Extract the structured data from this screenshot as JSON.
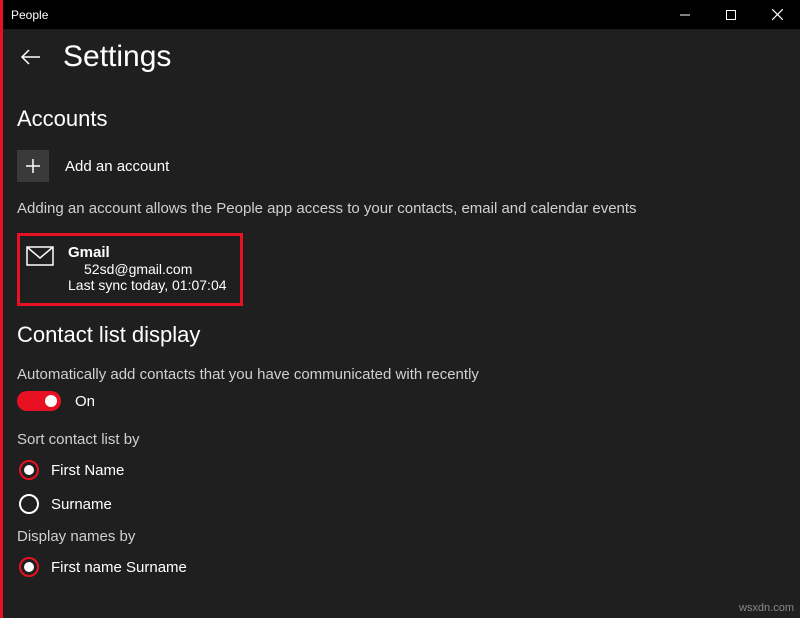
{
  "window": {
    "title": "People"
  },
  "header": {
    "title": "Settings"
  },
  "accounts": {
    "heading": "Accounts",
    "add_label": "Add an account",
    "description": "Adding an account allows the People app access to your contacts, email and calendar events",
    "item": {
      "name": "Gmail",
      "email": "52sd@gmail.com",
      "sync": "Last sync today, 01:07:04"
    }
  },
  "contact_display": {
    "heading": "Contact list display",
    "auto_add_label": "Automatically add contacts that you have communicated with recently",
    "toggle_state": "On",
    "sort_label": "Sort contact list by",
    "sort_options": {
      "first": "First Name",
      "surname": "Surname"
    },
    "display_label": "Display names by",
    "display_options": {
      "first_surname": "First name Surname"
    }
  },
  "watermark": "wsxdn.com"
}
